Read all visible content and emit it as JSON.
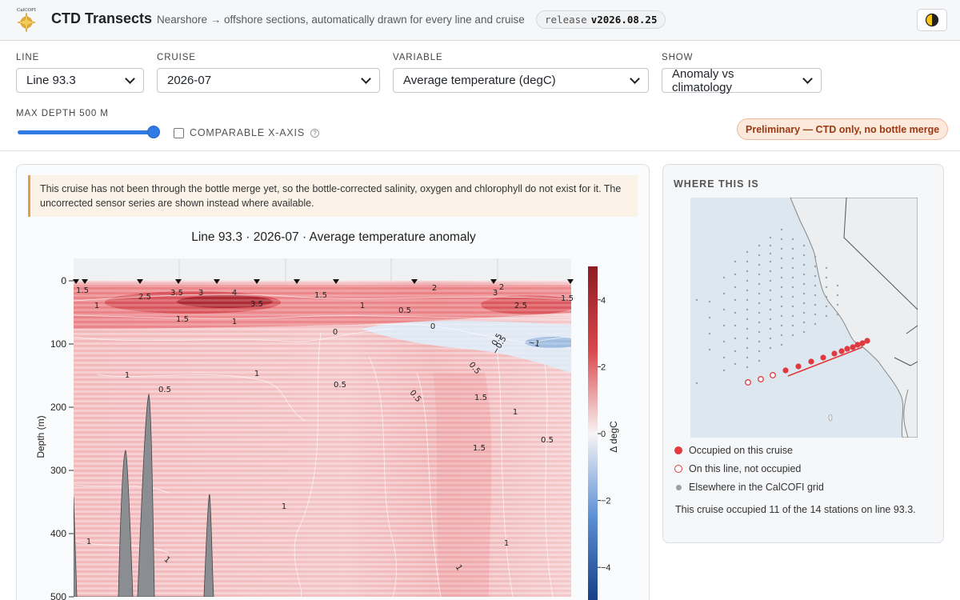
{
  "header": {
    "title": "CTD Transects",
    "subtitle": "Nearshore → offshore sections, automatically drawn for every line and cruise",
    "release_label": "release",
    "release_version": "v2026.08.25",
    "logo_text": "CalCOFI"
  },
  "controls": {
    "line": {
      "label": "LINE",
      "value": "Line 93.3"
    },
    "cruise": {
      "label": "CRUISE",
      "value": "2026-07"
    },
    "variable": {
      "label": "VARIABLE",
      "value": "Average temperature (degC)"
    },
    "show": {
      "label": "SHOW",
      "value": "Anomaly vs climatology"
    },
    "max_depth_label": "MAX DEPTH 500 M",
    "max_depth_value": 500,
    "comparable_x_axis_label": "COMPARABLE X-AXIS",
    "comparable_x_axis_checked": false,
    "status_badge": "Preliminary — CTD only, no bottle merge"
  },
  "notice": "This cruise has not been through the bottle merge yet, so the bottle-corrected salinity, oxygen and chlorophyll do not exist for it. The uncorrected sensor series are shown instead where available.",
  "chart_data": {
    "type": "heatmap",
    "title": "Line 93.3 · 2026-07 · Average temperature anomaly",
    "ylabel": "Depth (m)",
    "ylim": [
      500,
      0
    ],
    "y_ticks": [
      0,
      100,
      200,
      300,
      400,
      500
    ],
    "colorbar": {
      "label": "Δ degC",
      "ticks": [
        4,
        2,
        0,
        -2,
        -4
      ]
    },
    "contour_labels": [
      "1.5",
      "1",
      "2.5",
      "3.5",
      "3",
      "4",
      "3.5",
      "1.5",
      "1",
      "1.5",
      "0.5",
      "1",
      "2",
      "3",
      "2.5",
      "1.5",
      "2",
      "0",
      "0",
      "0.5",
      "-0.5",
      "-1",
      "1",
      "1",
      "0.5",
      "0.5",
      "0.5",
      "0.5",
      "1.5",
      "1",
      "0.5",
      "1.5",
      "1",
      "1",
      "1",
      "1",
      "1"
    ],
    "colors": {
      "positive": "#b2182b",
      "neutral": "#f7f7f7",
      "negative": "#2166ac",
      "bathymetry": "#8a8d91"
    }
  },
  "side": {
    "title": "WHERE THIS IS",
    "legend": [
      {
        "label": "Occupied on this cruise",
        "color": "#e0393e"
      },
      {
        "label": "On this line, not occupied",
        "color": "#e0393e"
      },
      {
        "label": "Elsewhere in the CalCOFI grid",
        "color": "#9aa0a6"
      }
    ],
    "summary": "This cruise occupied 11 of the 14 stations on line 93.3."
  }
}
